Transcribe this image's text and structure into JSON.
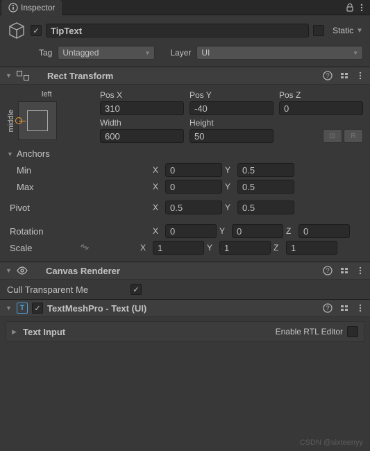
{
  "tab": {
    "title": "Inspector"
  },
  "header": {
    "enabled": true,
    "name": "TipText",
    "static_label": "Static",
    "static_checked": false,
    "tag_label": "Tag",
    "tag_value": "Untagged",
    "layer_label": "Layer",
    "layer_value": "UI"
  },
  "rectTransform": {
    "title": "Rect Transform",
    "anchor_top": "left",
    "anchor_side": "middle",
    "posx_label": "Pos X",
    "posx": "310",
    "posy_label": "Pos Y",
    "posy": "-40",
    "posz_label": "Pos Z",
    "posz": "0",
    "width_label": "Width",
    "width": "600",
    "height_label": "Height",
    "height": "50",
    "anchors_label": "Anchors",
    "min_label": "Min",
    "min_x": "0",
    "min_y": "0.5",
    "max_label": "Max",
    "max_x": "0",
    "max_y": "0.5",
    "pivot_label": "Pivot",
    "pivot_x": "0.5",
    "pivot_y": "0.5",
    "rotation_label": "Rotation",
    "rot_x": "0",
    "rot_y": "0",
    "rot_z": "0",
    "scale_label": "Scale",
    "scale_x": "1",
    "scale_y": "1",
    "scale_z": "1",
    "axis_x": "X",
    "axis_y": "Y",
    "axis_z": "Z",
    "blueprint_tool": "⊡",
    "raw_tool": "R"
  },
  "canvasRenderer": {
    "title": "Canvas Renderer",
    "cull_label": "Cull Transparent Me",
    "cull_checked": true
  },
  "tmp": {
    "title": "TextMeshPro - Text (UI)",
    "enabled": true,
    "text_input_label": "Text Input",
    "rtl_label": "Enable RTL Editor",
    "rtl_checked": false
  },
  "watermark": "CSDN @sixteenyy"
}
